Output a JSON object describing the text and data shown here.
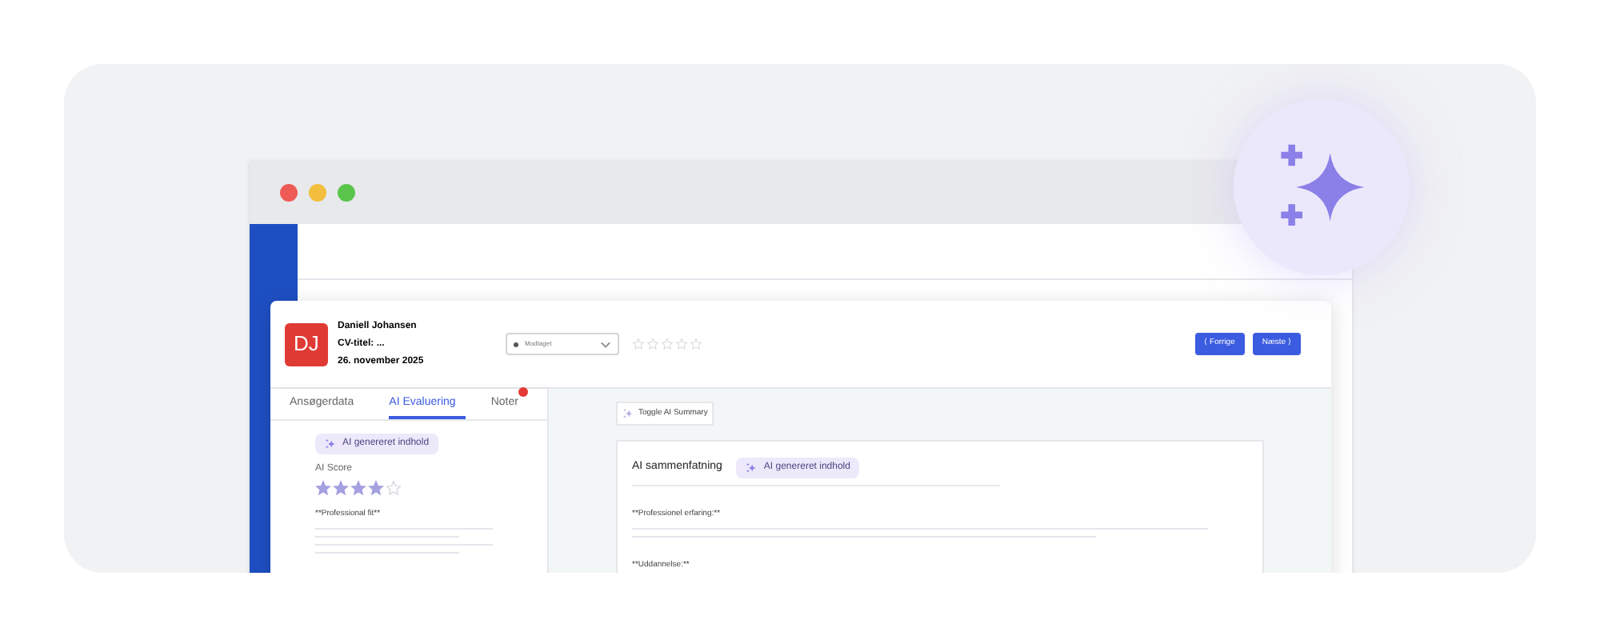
{
  "candidate": {
    "initials": "DJ",
    "name": "Daniell Johansen",
    "cv_title": "CV-titel: ...",
    "date": "26. november 2025",
    "status": "Modtaget",
    "stars": 0
  },
  "nav": {
    "previous": "⟨ Forrige",
    "next": "Næste ⟩"
  },
  "tabs": [
    {
      "label": "Ansøgerdata",
      "selected": false,
      "badge": false
    },
    {
      "label": "AI Evaluering",
      "selected": true,
      "badge": false
    },
    {
      "label": "Noter",
      "selected": false,
      "badge": true
    }
  ],
  "evaluation": {
    "tag": "AI genereret indhold",
    "score_label": "AI Score",
    "stars": 4,
    "section": "**Professional fit**"
  },
  "summary": {
    "toggle": "Toggle AI Summary",
    "title": "AI sammenfatning",
    "tag": "AI genereret indhold",
    "sections": [
      "**Professionel erfaring:**",
      "**Uddannelse:**"
    ]
  }
}
